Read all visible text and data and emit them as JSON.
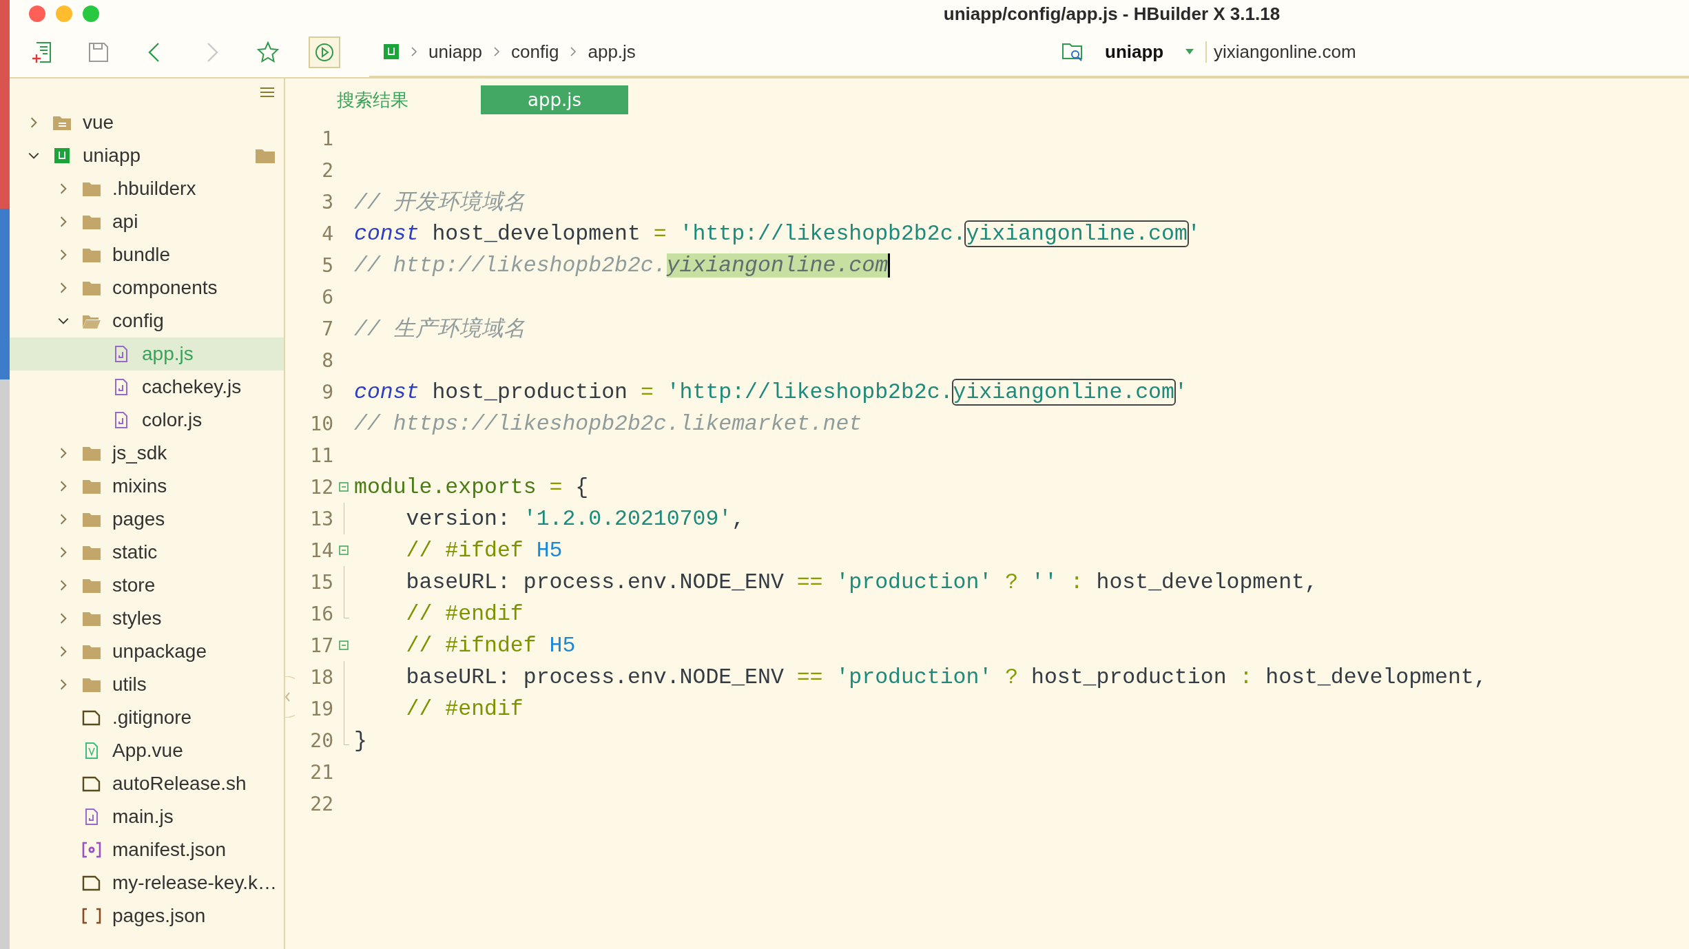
{
  "window": {
    "title": "uniapp/config/app.js - HBuilder X 3.1.18"
  },
  "toolbar": {
    "breadcrumb": [
      "uniapp",
      "config",
      "app.js"
    ],
    "project": "uniapp",
    "search": {
      "value": "yixiangonline.com"
    }
  },
  "sidebar": {
    "tree": [
      {
        "label": "vue",
        "kind": "folder-doc",
        "expanded": false,
        "selected": false
      },
      {
        "label": "uniapp",
        "kind": "project",
        "expanded": true,
        "selected": false,
        "children": [
          {
            "label": ".hbuilderx",
            "kind": "folder",
            "expanded": false,
            "selected": false
          },
          {
            "label": "api",
            "kind": "folder",
            "expanded": false,
            "selected": false
          },
          {
            "label": "bundle",
            "kind": "folder",
            "expanded": false,
            "selected": false
          },
          {
            "label": "components",
            "kind": "folder",
            "expanded": false,
            "selected": false
          },
          {
            "label": "config",
            "kind": "folder",
            "expanded": true,
            "selected": false,
            "children": [
              {
                "label": "app.js",
                "kind": "js",
                "selected": true
              },
              {
                "label": "cachekey.js",
                "kind": "js",
                "selected": false
              },
              {
                "label": "color.js",
                "kind": "js",
                "selected": false
              }
            ]
          },
          {
            "label": "js_sdk",
            "kind": "folder",
            "expanded": false,
            "selected": false
          },
          {
            "label": "mixins",
            "kind": "folder",
            "expanded": false,
            "selected": false
          },
          {
            "label": "pages",
            "kind": "folder",
            "expanded": false,
            "selected": false
          },
          {
            "label": "static",
            "kind": "folder",
            "expanded": false,
            "selected": false
          },
          {
            "label": "store",
            "kind": "folder",
            "expanded": false,
            "selected": false
          },
          {
            "label": "styles",
            "kind": "folder",
            "expanded": false,
            "selected": false
          },
          {
            "label": "unpackage",
            "kind": "folder",
            "expanded": false,
            "selected": false
          },
          {
            "label": "utils",
            "kind": "folder",
            "expanded": false,
            "selected": false
          },
          {
            "label": ".gitignore",
            "kind": "file",
            "selected": false
          },
          {
            "label": "App.vue",
            "kind": "vue",
            "selected": false
          },
          {
            "label": "autoRelease.sh",
            "kind": "file",
            "selected": false
          },
          {
            "label": "main.js",
            "kind": "js",
            "selected": false
          },
          {
            "label": "manifest.json",
            "kind": "config",
            "selected": false
          },
          {
            "label": "my-release-key.k…",
            "kind": "file",
            "selected": false
          },
          {
            "label": "pages.json",
            "kind": "json",
            "selected": false
          }
        ]
      }
    ]
  },
  "tabs": [
    {
      "label": "搜索结果",
      "selected": false
    },
    {
      "label": "app.js",
      "selected": true
    }
  ],
  "editor": {
    "lines": [
      {
        "number": "1"
      },
      {
        "number": "2"
      },
      {
        "number": "3",
        "tokens": [
          {
            "kind": "comment",
            "text": "// 开发环境域名"
          }
        ]
      },
      {
        "number": "4",
        "tokens": [
          {
            "kind": "keyword",
            "text": "const"
          },
          {
            "kind": "plain",
            "text": " host_development "
          },
          {
            "kind": "op",
            "text": "="
          },
          {
            "kind": "string",
            "text": " 'http://likeshopb2b2c."
          },
          {
            "kind": "match",
            "text": "yixiangonline.com"
          },
          {
            "kind": "string",
            "text": "'"
          }
        ]
      },
      {
        "number": "5",
        "tokens": [
          {
            "kind": "comment",
            "text": "// http://likeshopb2b2c."
          },
          {
            "kind": "selection",
            "text": "yixiangonline.com"
          }
        ]
      },
      {
        "number": "6"
      },
      {
        "number": "7",
        "tokens": [
          {
            "kind": "comment",
            "text": "// 生产环境域名"
          }
        ]
      },
      {
        "number": "8"
      },
      {
        "number": "9",
        "tokens": [
          {
            "kind": "keyword",
            "text": "const"
          },
          {
            "kind": "plain",
            "text": " host_production "
          },
          {
            "kind": "op",
            "text": "="
          },
          {
            "kind": "string",
            "text": " 'http://likeshopb2b2c."
          },
          {
            "kind": "match",
            "text": "yixiangonline.com"
          },
          {
            "kind": "string",
            "text": "'"
          }
        ]
      },
      {
        "number": "10",
        "tokens": [
          {
            "kind": "comment",
            "text": "// https://likeshopb2b2c.likemarket.net"
          }
        ]
      },
      {
        "number": "11"
      },
      {
        "number": "12",
        "kind": "fold-start",
        "tokens": [
          {
            "kind": "module",
            "text": "module.exports"
          },
          {
            "kind": "op",
            "text": " ="
          },
          {
            "kind": "plain",
            "text": " {"
          }
        ]
      },
      {
        "number": "13",
        "kind": "guide",
        "tokens": [
          {
            "kind": "plain",
            "text": "    version: "
          },
          {
            "kind": "string",
            "text": "'1.2.0.20210709'"
          },
          {
            "kind": "plain",
            "text": ","
          }
        ]
      },
      {
        "number": "14",
        "kind": "fold-start",
        "tokens": [
          {
            "kind": "directive",
            "text": "    // #ifdef "
          },
          {
            "kind": "platform",
            "text": "H5"
          }
        ]
      },
      {
        "number": "15",
        "kind": "guide",
        "tokens": [
          {
            "kind": "plain",
            "text": "    baseURL: process.env.NODE_ENV "
          },
          {
            "kind": "op",
            "text": "=="
          },
          {
            "kind": "string",
            "text": " 'production' "
          },
          {
            "kind": "op",
            "text": "?"
          },
          {
            "kind": "string",
            "text": " '' "
          },
          {
            "kind": "op",
            "text": ":"
          },
          {
            "kind": "plain",
            "text": " host_development,"
          }
        ]
      },
      {
        "number": "16",
        "kind": "guide-end",
        "tokens": [
          {
            "kind": "directive",
            "text": "    // #endif"
          }
        ]
      },
      {
        "number": "17",
        "kind": "fold-start",
        "tokens": [
          {
            "kind": "directive",
            "text": "    // #ifndef "
          },
          {
            "kind": "platform",
            "text": "H5"
          }
        ]
      },
      {
        "number": "18",
        "kind": "guide",
        "tokens": [
          {
            "kind": "plain",
            "text": "    baseURL: process.env.NODE_ENV "
          },
          {
            "kind": "op",
            "text": "=="
          },
          {
            "kind": "string",
            "text": " 'production' "
          },
          {
            "kind": "op",
            "text": "?"
          },
          {
            "kind": "plain",
            "text": " host_production "
          },
          {
            "kind": "op",
            "text": ":"
          },
          {
            "kind": "plain",
            "text": " host_development,"
          }
        ]
      },
      {
        "number": "19",
        "kind": "guide",
        "tokens": [
          {
            "kind": "directive",
            "text": "    // #endif"
          }
        ]
      },
      {
        "number": "20",
        "kind": "guide-end",
        "tokens": [
          {
            "kind": "plain",
            "text": "}"
          }
        ]
      },
      {
        "number": "21"
      },
      {
        "number": "22"
      }
    ]
  }
}
